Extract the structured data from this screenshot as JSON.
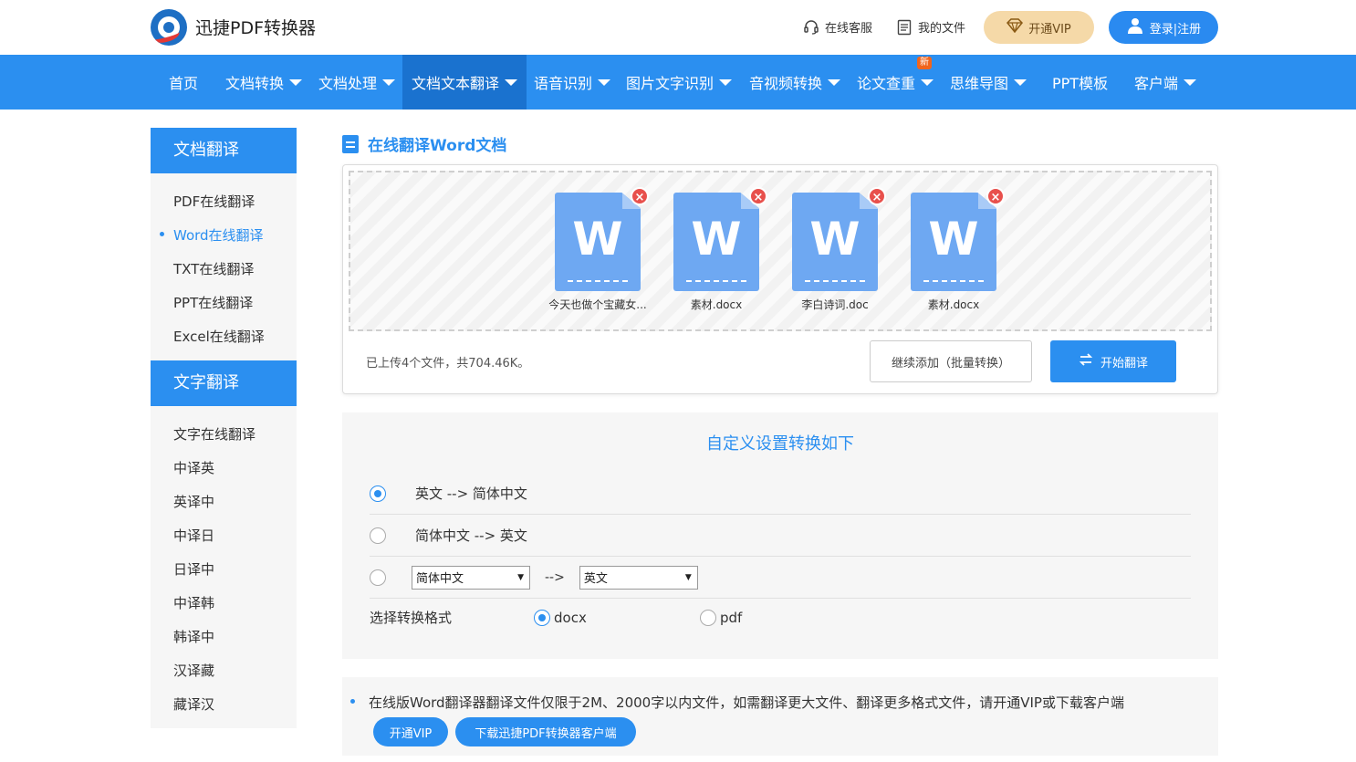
{
  "header": {
    "brand": "迅捷PDF转换器",
    "support": "在线客服",
    "my_files": "我的文件",
    "vip": "开通VIP",
    "login": "登录|注册"
  },
  "nav": {
    "items": [
      {
        "label": "首页"
      },
      {
        "label": "文档转换"
      },
      {
        "label": "文档处理"
      },
      {
        "label": "文档文本翻译"
      },
      {
        "label": "语音识别"
      },
      {
        "label": "图片文字识别"
      },
      {
        "label": "音视频转换"
      },
      {
        "label": "论文查重",
        "badge": "新"
      },
      {
        "label": "思维导图"
      },
      {
        "label": "PPT模板"
      },
      {
        "label": "客户端"
      }
    ]
  },
  "sidebar": {
    "section1": "文档翻译",
    "doc_items": [
      "PDF在线翻译",
      "Word在线翻译",
      "TXT在线翻译",
      "PPT在线翻译",
      "Excel在线翻译"
    ],
    "section2": "文字翻译",
    "text_items": [
      "文字在线翻译",
      "中译英",
      "英译中",
      "中译日",
      "日译中",
      "中译韩",
      "韩译中",
      "汉译藏",
      "藏译汉"
    ]
  },
  "main": {
    "title": "在线翻译Word文档"
  },
  "upload": {
    "files": [
      {
        "name": "今天也做个宝藏女..."
      },
      {
        "name": "素材.docx"
      },
      {
        "name": "李白诗词.doc"
      },
      {
        "name": "素材.docx"
      }
    ],
    "file_letter": "W",
    "info": "已上传4个文件，共704.46K。",
    "continue": "继续添加（批量转换）",
    "start": "开始翻译"
  },
  "settings": {
    "title": "自定义设置转换如下",
    "opt1": "英文 --> 简体中文",
    "opt2": "简体中文 --> 英文",
    "from_select": "简体中文",
    "arrow": "-->",
    "to_select": "英文",
    "format_label": "选择转换格式",
    "fmt_docx": "docx",
    "fmt_pdf": "pdf"
  },
  "notice": {
    "text": "在线版Word翻译器翻译文件仅限于2M、2000字以内文件，如需翻译更大文件、翻译更多格式文件，请开通VIP或下载客户端",
    "vip_btn": "开通VIP",
    "download_btn": "下载迅捷PDF转换器客户端"
  },
  "colors": {
    "primary": "#2b8ff0",
    "active_nav": "#1a72cf",
    "vip_bg": "#f5d9a8",
    "close": "#e8504c"
  }
}
